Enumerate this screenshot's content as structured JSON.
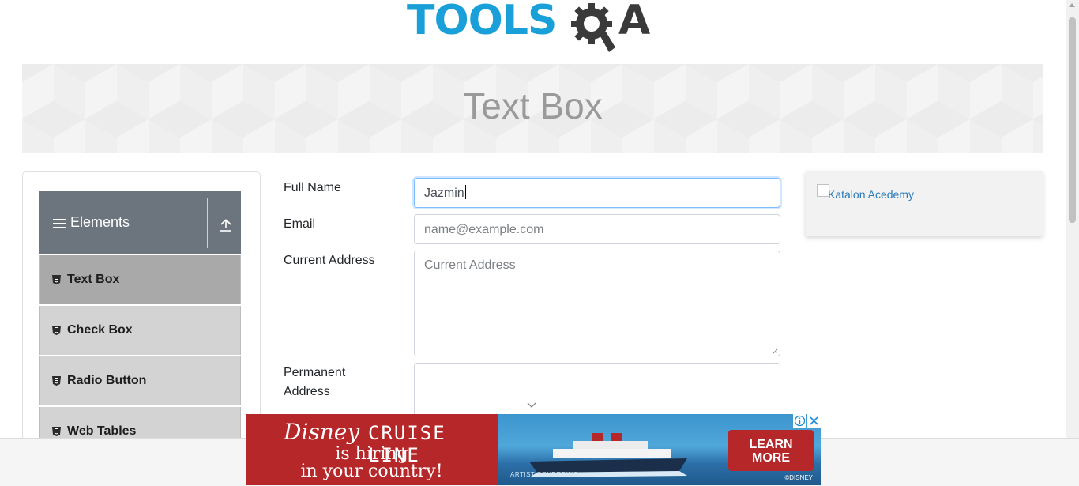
{
  "logo": {
    "text_main": "TOOLS",
    "text_end": "A",
    "colors": {
      "blue": "#1aa0d8",
      "dark": "#3a3a3a"
    }
  },
  "banner": {
    "title": "Text Box"
  },
  "sidebar": {
    "group_title": "Elements",
    "items": [
      {
        "label": "Text Box",
        "active": true
      },
      {
        "label": "Check Box",
        "active": false
      },
      {
        "label": "Radio Button",
        "active": false
      },
      {
        "label": "Web Tables",
        "active": false
      }
    ]
  },
  "form": {
    "full_name": {
      "label": "Full Name",
      "value": "Jazmin"
    },
    "email": {
      "label": "Email",
      "placeholder": "name@example.com",
      "value": ""
    },
    "current_address": {
      "label": "Current Address",
      "placeholder": "Current Address",
      "value": ""
    },
    "permanent_address": {
      "label_line1": "Permanent",
      "label_line2": "Address",
      "value": ""
    }
  },
  "side_ad": {
    "alt_text": "Katalon Acedemy"
  },
  "bottom_ad": {
    "brand": "Disney",
    "headline": "CRUISE LINE",
    "line2": "is hiring",
    "line3": "in your country!",
    "button_line1": "LEARN",
    "button_line2": "MORE",
    "rendering_note": "ARTIST RENDERING",
    "copyright": "©DISNEY",
    "colors": {
      "red": "#b6272a",
      "sea": "#3d95cf"
    }
  }
}
